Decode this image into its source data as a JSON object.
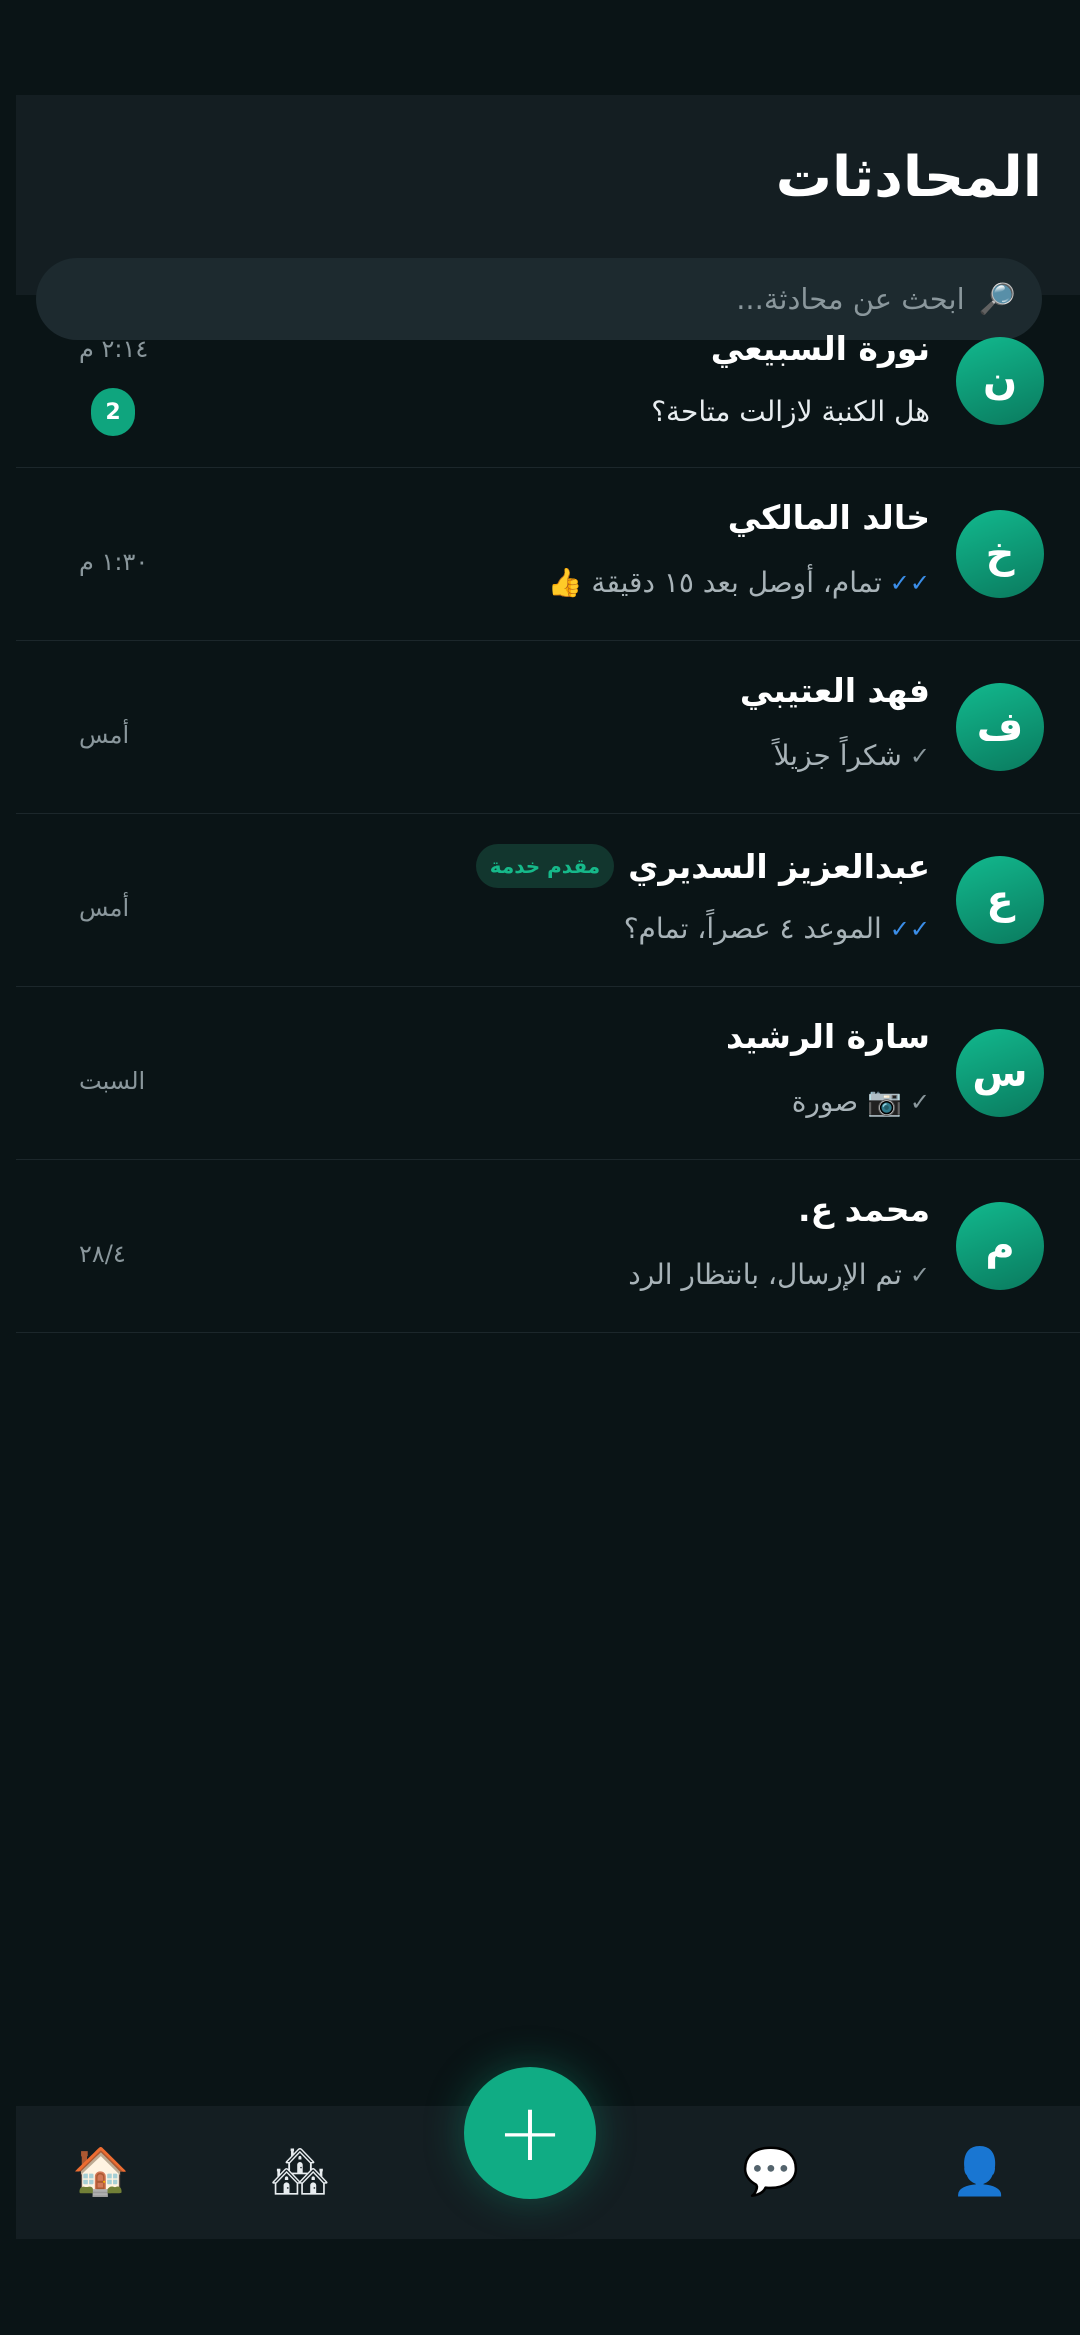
{
  "header": {
    "title": "المحادثات"
  },
  "search": {
    "placeholder": "ابحث عن محادثة...",
    "icon": "🔎"
  },
  "conversations": [
    {
      "initial": "ن",
      "name": "نورة السبيعي",
      "badge": "",
      "status": "",
      "preview": "هل الكنبة لازالت متاحة؟",
      "time": "٢:١٤ م",
      "unread": "2"
    },
    {
      "initial": "خ",
      "name": "خالد المالكي",
      "badge": "",
      "status": "✓✓",
      "preview": "تمام، أوصل بعد ١٥ دقيقة 👍",
      "time": "١:٣٠ م",
      "unread": ""
    },
    {
      "initial": "ف",
      "name": "فهد العتيبي",
      "badge": "",
      "status": "✓",
      "preview": "شكراً جزيلاً",
      "time": "أمس",
      "unread": ""
    },
    {
      "initial": "ع",
      "name": "عبدالعزيز السديري",
      "badge": "مقدم خدمة",
      "status": "✓✓",
      "preview": "الموعد ٤ عصراً، تمام؟",
      "time": "أمس",
      "unread": ""
    },
    {
      "initial": "س",
      "name": "سارة الرشيد",
      "badge": "",
      "status": "✓",
      "preview": "📷 صورة",
      "time": "السبت",
      "unread": ""
    },
    {
      "initial": "م",
      "name": "محمد ع.",
      "badge": "",
      "status": "✓",
      "preview": "تم الإرسال، بانتظار الرد",
      "time": "٢٨/٤",
      "unread": ""
    }
  ],
  "nav": {
    "home_icon": "🏠",
    "market_icon": "🏘",
    "add_label": "+",
    "chat_icon": "💬",
    "profile_icon": "👤"
  }
}
